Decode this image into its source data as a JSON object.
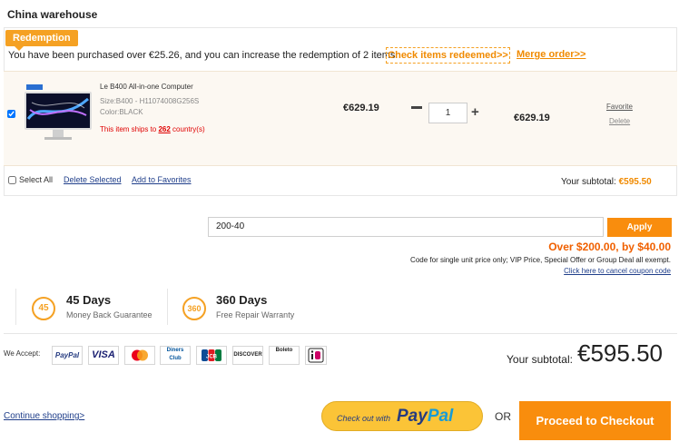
{
  "warehouse": {
    "title": "China warehouse"
  },
  "redemption": {
    "tag": "Redemption",
    "message": "You have been purchased over €25.26, and you can increase the redemption of 2 items",
    "check_link": "Check items redeemed>>",
    "merge_link": "Merge order>>"
  },
  "item": {
    "name": "Le B400 All-in-one Computer",
    "size": "Size:B400 - H11074008G256S",
    "color": "Color:BLACK",
    "ship_prefix": "This item ships to ",
    "ship_count": "262",
    "ship_suffix": " country(s)",
    "unit_price": "€629.19",
    "quantity": "1",
    "line_total": "€629.19",
    "favorite_label": "Favorite",
    "delete_label": "Delete",
    "checked": true
  },
  "cart_footer": {
    "select_all": "Select All",
    "delete_selected": "Delete Selected",
    "add_favorites": "Add to Favorites",
    "subtotal_label": "Your subtotal:",
    "subtotal_value": "€595.50"
  },
  "coupon": {
    "code": "200-40",
    "apply_label": "Apply",
    "discount": "Over $200.00, by $40.00",
    "rule": "Code for single unit price only; VIP Price, Special Offer or Group Deal all exempt.",
    "cancel_link": "Click here to cancel coupon code"
  },
  "guarantees": [
    {
      "badge": "45",
      "title": "45 Days",
      "subtitle": "Money Back Guarantee"
    },
    {
      "badge": "360",
      "title": "360 Days",
      "subtitle": "Free Repair Warranty"
    }
  ],
  "payment": {
    "we_accept": "We Accept:",
    "methods": [
      "PayPal",
      "VISA",
      "",
      "Diners Club",
      "JCB",
      "DISCOVER",
      "Boleto",
      ""
    ],
    "icons": [
      "paypal-icon",
      "visa-icon",
      "mastercard-icon",
      "diners-club-icon",
      "jcb-icon",
      "discover-icon",
      "boleto-icon",
      "ideal-icon"
    ]
  },
  "summary": {
    "subtotal_label": "Your subtotal:",
    "subtotal_value": "€595.50"
  },
  "actions": {
    "continue_shopping": "Continue shopping>",
    "paypal_small": "Check out with",
    "paypal_big_a": "Pay",
    "paypal_big_b": "Pal",
    "or": "OR",
    "proceed": "Proceed to Checkout"
  },
  "colors": {
    "accent": "#f98d0d",
    "tag": "#f5a123",
    "link": "#1f3e8a",
    "warning": "#e00000"
  }
}
